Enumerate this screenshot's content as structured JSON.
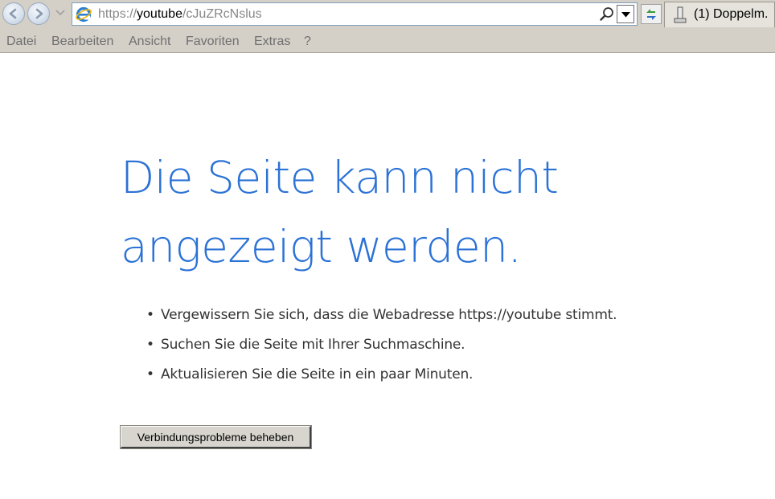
{
  "browser": {
    "address": {
      "scheme": "https://",
      "domain": "youtube",
      "path": "/cJuZRcNslus"
    },
    "tab_title": "(1) Doppelm."
  },
  "menu": {
    "items": [
      "Datei",
      "Bearbeiten",
      "Ansicht",
      "Favoriten",
      "Extras",
      "?"
    ]
  },
  "error_page": {
    "headline": "Die Seite kann nicht angezeigt werden.",
    "tips": [
      "Vergewissern Sie sich, dass die Webadresse https://youtube stimmt.",
      "Suchen Sie die Seite mit Ihrer Suchmaschine.",
      "Aktualisieren Sie die Seite in ein paar Minuten."
    ],
    "fix_button_label": "Verbindungsprobleme beheben"
  },
  "colors": {
    "headline": "#2b72d6",
    "toolbar_bg": "#d4d0c8",
    "menu_text": "#6f6f6f"
  },
  "icons": [
    "back-arrow-icon",
    "forward-arrow-icon",
    "ie-logo-icon",
    "search-icon",
    "chevron-down-icon",
    "refresh-icon",
    "tab-page-icon"
  ]
}
